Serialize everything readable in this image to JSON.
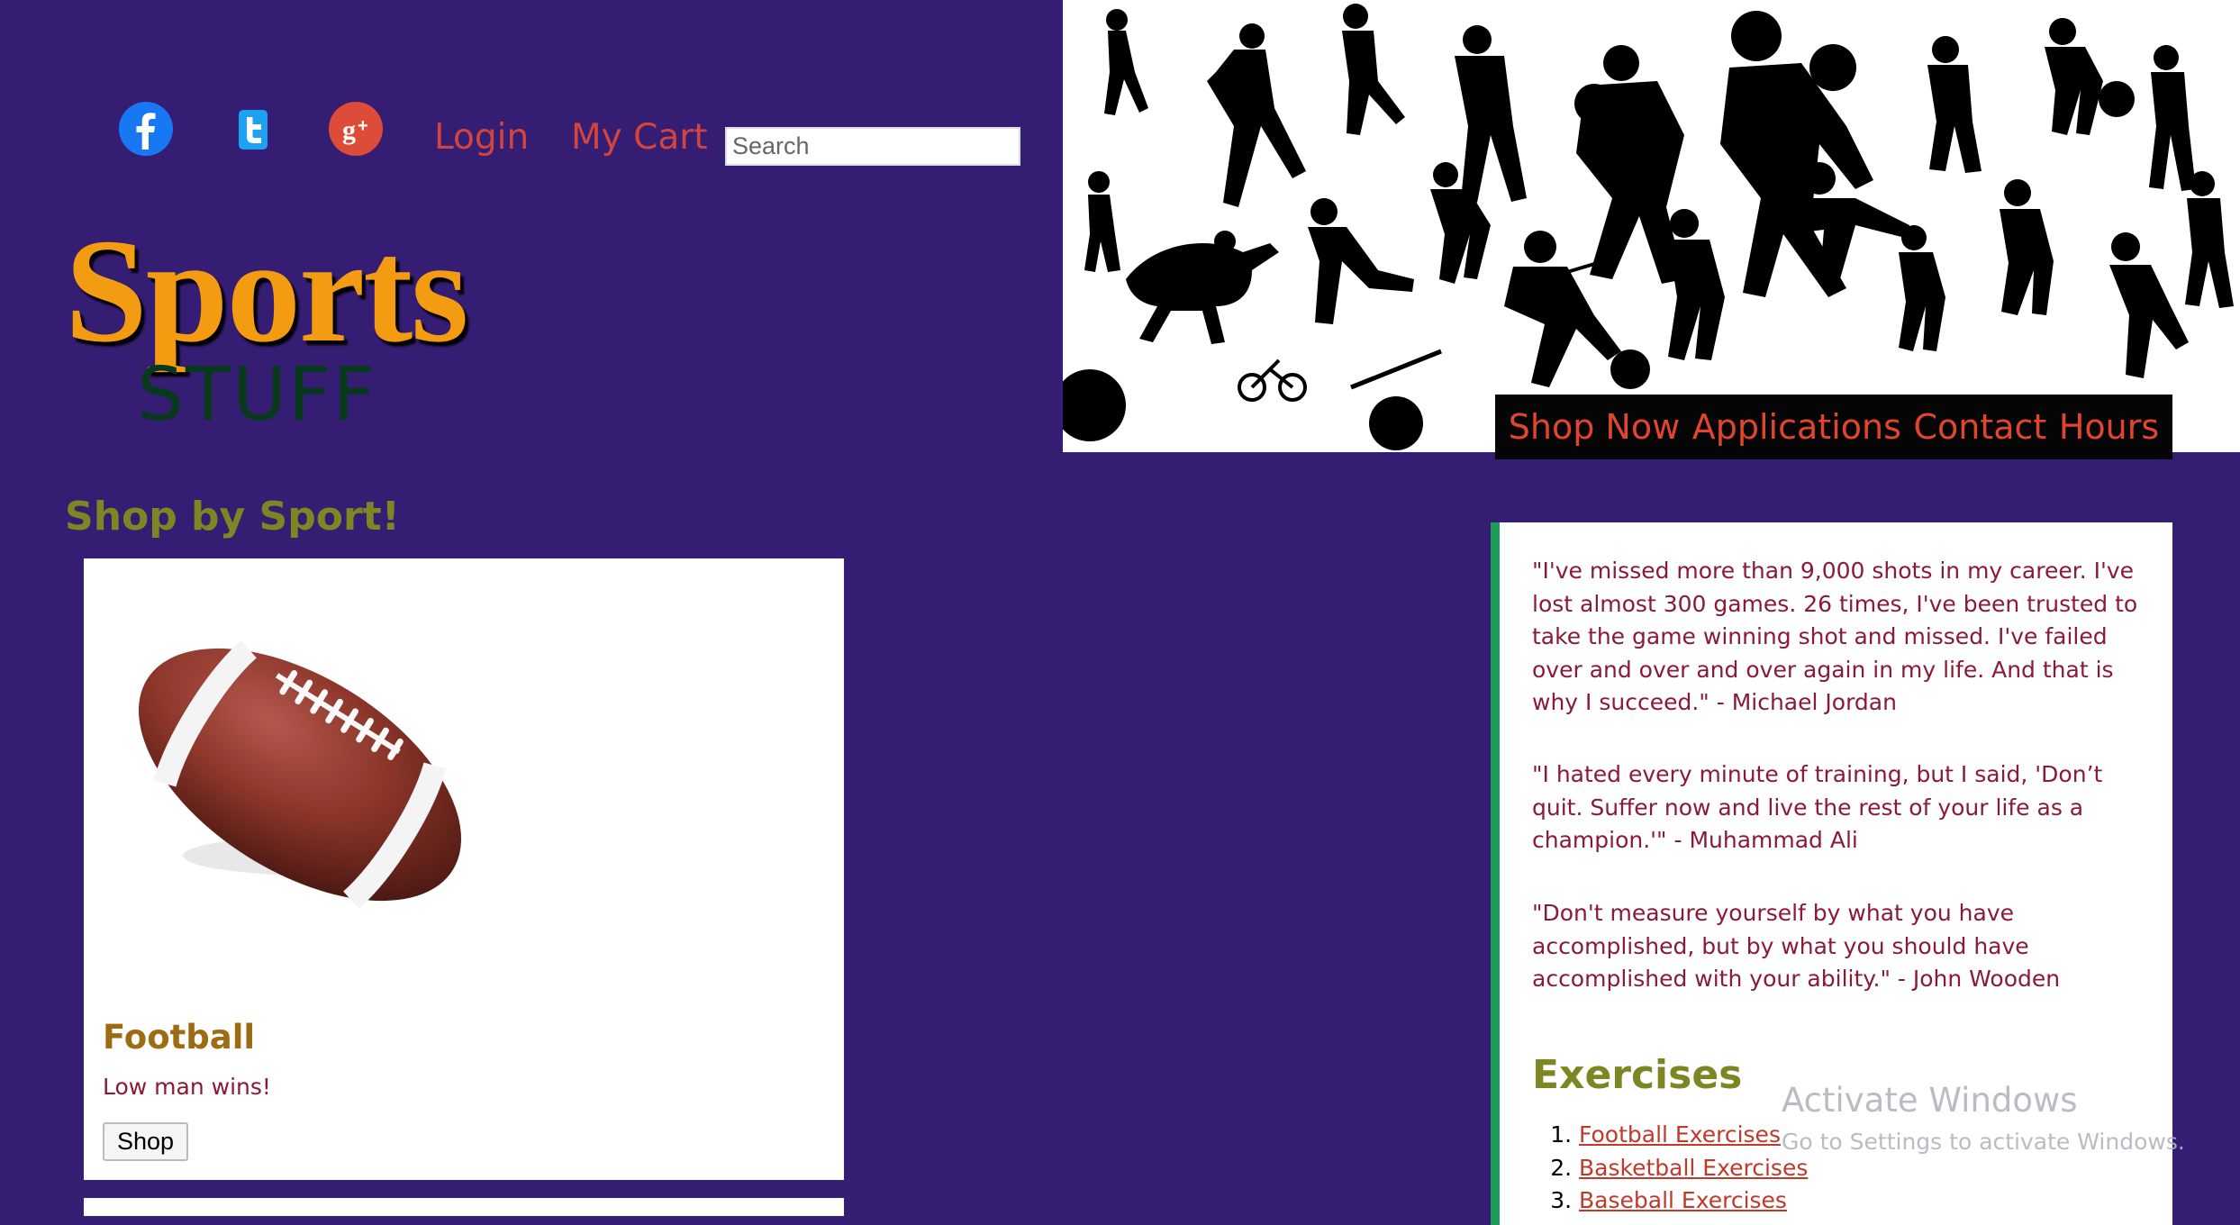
{
  "header": {
    "social": [
      {
        "icon": "facebook-icon",
        "color": "#1877f2"
      },
      {
        "icon": "twitter-icon",
        "color": "#1da1f2"
      },
      {
        "icon": "google-plus-icon",
        "color": "#dd4b39"
      }
    ],
    "login_label": "Login",
    "cart_label": "My Cart",
    "search_placeholder": "Search"
  },
  "logo": {
    "top": "Sports",
    "bottom": "STUFF"
  },
  "nav": {
    "items": [
      "Shop Now",
      "Applications",
      "Contact",
      "Hours"
    ]
  },
  "shop": {
    "heading": "Shop by Sport!",
    "card": {
      "title": "Football",
      "text": "Low man wins!",
      "button": "Shop"
    }
  },
  "quotes": [
    "\"I've missed more than 9,000 shots in my career. I've lost almost 300 games. 26 times, I've been trusted to take the game winning shot and missed. I've failed over and over and over again in my life. And that is why I succeed.\" - Michael Jordan",
    "\"I hated every minute of training, but I said, 'Don’t quit. Suffer now and live the rest of your life as a champion.'\" - Muhammad Ali",
    "\"Don't measure yourself by what you have accomplished, but by what you should have accomplished with your ability.\" - John Wooden"
  ],
  "exercises": {
    "heading": "Exercises",
    "items": [
      "Football Exercises",
      "Basketball Exercises",
      "Baseball Exercises"
    ]
  },
  "watermark": {
    "line1": "Activate Windows",
    "line2": "Go to Settings to activate Windows."
  },
  "colors": {
    "background": "#341d72",
    "accent": "#f39c12",
    "link": "#d2443f",
    "aside_border": "#1e9d58"
  }
}
